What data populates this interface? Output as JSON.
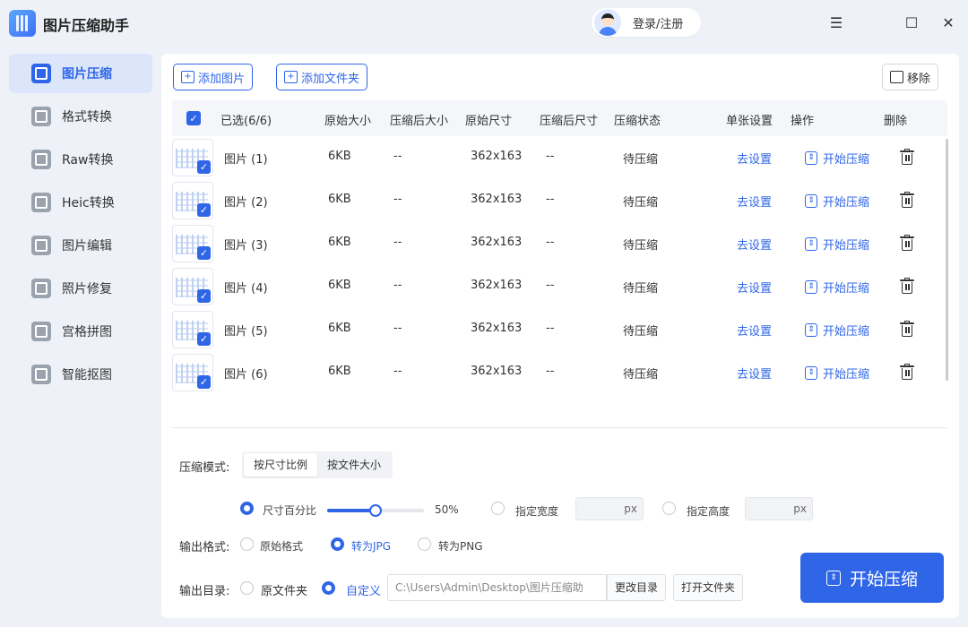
{
  "app": {
    "title": "图片压缩助手"
  },
  "header": {
    "login_label": "登录/注册"
  },
  "window_controls": {
    "menu": "☰",
    "maximize": "☐",
    "close": "✕"
  },
  "colors": {
    "accent": "#2f66e8",
    "active_bg": "#dbe6fb"
  },
  "sidebar": {
    "items": [
      {
        "label": "图片压缩",
        "icon": "image-compress-icon",
        "active": true
      },
      {
        "label": "格式转换",
        "icon": "format-convert-icon"
      },
      {
        "label": "Raw转换",
        "icon": "raw-convert-icon"
      },
      {
        "label": "Heic转换",
        "icon": "heic-convert-icon"
      },
      {
        "label": "图片编辑",
        "icon": "image-edit-icon"
      },
      {
        "label": "照片修复",
        "icon": "photo-repair-icon"
      },
      {
        "label": "宫格拼图",
        "icon": "grid-collage-icon"
      },
      {
        "label": "智能抠图",
        "icon": "smart-cutout-icon"
      }
    ]
  },
  "toolbar": {
    "add_image": "添加图片",
    "add_folder": "添加文件夹",
    "remove": "移除"
  },
  "table": {
    "headers": {
      "selected": "已选(6/6)",
      "original_size": "原始大小",
      "compressed_size": "压缩后大小",
      "original_dim": "原始尺寸",
      "compressed_dim": "压缩后尺寸",
      "status": "压缩状态",
      "single_setting": "单张设置",
      "operation": "操作",
      "delete": "删除"
    },
    "rows": [
      {
        "name": "图片 (1)",
        "size": "6KB",
        "compressed_size": "--",
        "dim": "362x163",
        "compressed_dim": "--",
        "status": "待压缩",
        "setting": "去设置",
        "action": "开始压缩"
      },
      {
        "name": "图片 (2)",
        "size": "6KB",
        "compressed_size": "--",
        "dim": "362x163",
        "compressed_dim": "--",
        "status": "待压缩",
        "setting": "去设置",
        "action": "开始压缩"
      },
      {
        "name": "图片 (3)",
        "size": "6KB",
        "compressed_size": "--",
        "dim": "362x163",
        "compressed_dim": "--",
        "status": "待压缩",
        "setting": "去设置",
        "action": "开始压缩"
      },
      {
        "name": "图片 (4)",
        "size": "6KB",
        "compressed_size": "--",
        "dim": "362x163",
        "compressed_dim": "--",
        "status": "待压缩",
        "setting": "去设置",
        "action": "开始压缩"
      },
      {
        "name": "图片 (5)",
        "size": "6KB",
        "compressed_size": "--",
        "dim": "362x163",
        "compressed_dim": "--",
        "status": "待压缩",
        "setting": "去设置",
        "action": "开始压缩"
      },
      {
        "name": "图片 (6)",
        "size": "6KB",
        "compressed_size": "--",
        "dim": "362x163",
        "compressed_dim": "--",
        "status": "待压缩",
        "setting": "去设置",
        "action": "开始压缩"
      }
    ]
  },
  "settings": {
    "mode_label": "压缩模式:",
    "mode_options": [
      "按尺寸比例",
      "按文件大小"
    ],
    "size_percent_label": "尺寸百分比",
    "size_percent_value": "50%",
    "size_percent": 50,
    "width_label": "指定宽度",
    "height_label": "指定高度",
    "px": "px",
    "format_label": "输出格式:",
    "format_options": [
      "原始格式",
      "转为JPG",
      "转为PNG"
    ],
    "dir_label": "输出目录:",
    "dir_options": [
      "原文件夹",
      "自定义"
    ],
    "dir_path": "C:\\Users\\Admin\\Desktop\\图片压缩助",
    "change_dir": "更改目录",
    "open_folder": "打开文件夹"
  },
  "main_action": {
    "label": "开始压缩"
  }
}
